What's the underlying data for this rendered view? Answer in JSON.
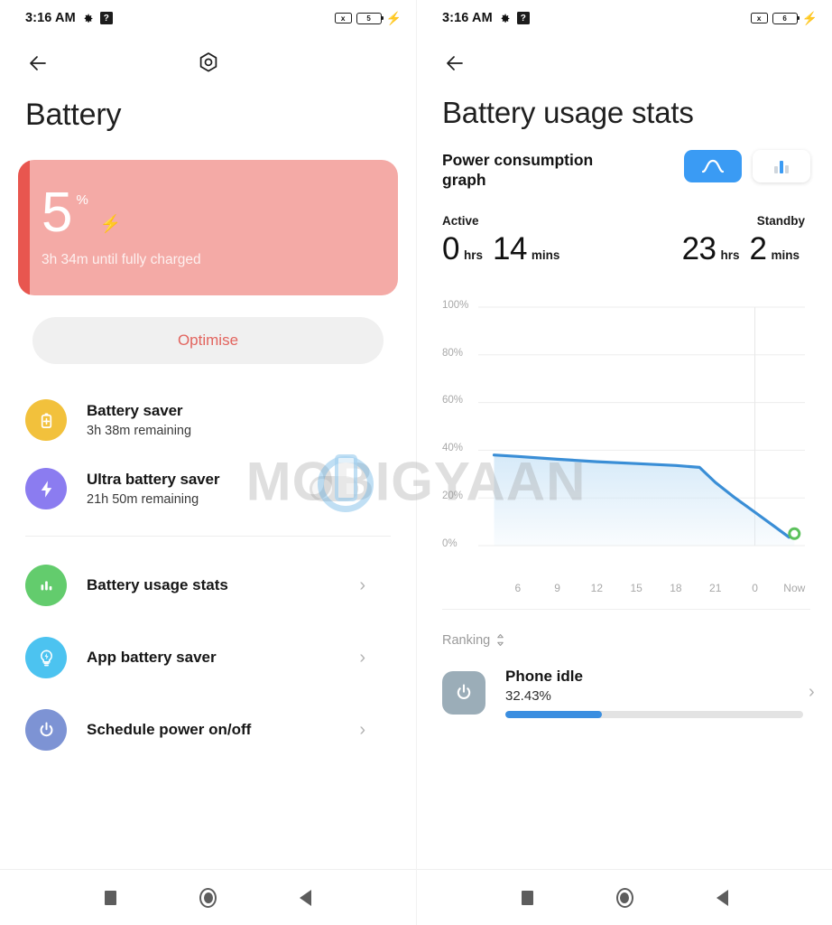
{
  "left": {
    "statusbar": {
      "time": "3:16 AM",
      "gear_icon": "gear-icon",
      "question_icon": "?",
      "x_icon": "x",
      "battery_level": "5",
      "bolt_icon": "⚡"
    },
    "appbar": {
      "back_icon": "back-arrow-icon",
      "settings_icon": "hex-settings-icon"
    },
    "title": "Battery",
    "battery_card": {
      "percent": "5",
      "percent_symbol": "%",
      "charging_icon": "bolt-icon",
      "status": "3h 34m until fully charged",
      "card_color": "#f4aaa6",
      "accent_color": "#e8564f"
    },
    "optimise_label": "Optimise",
    "savers": [
      {
        "title": "Battery saver",
        "subtitle": "3h 38m remaining",
        "icon": "battery-plus-icon",
        "color": "#f2c13c",
        "has_toggle": false
      },
      {
        "title": "Ultra battery saver",
        "subtitle": "21h 50m remaining",
        "icon": "bolt-icon",
        "color": "#8b7cf0",
        "has_toggle": true,
        "toggle_on": false
      }
    ],
    "menu": [
      {
        "label": "Battery usage stats",
        "icon": "bar-chart-icon",
        "color": "#63cc6d",
        "chevron": "›"
      },
      {
        "label": "App battery saver",
        "icon": "bulb-bolt-icon",
        "color": "#4cc3f0",
        "chevron": "›"
      },
      {
        "label": "Schedule power on/off",
        "icon": "power-icon",
        "color": "#7d93d4",
        "chevron": "›"
      }
    ]
  },
  "right": {
    "statusbar": {
      "time": "3:16 AM",
      "gear_icon": "gear-icon",
      "question_icon": "?",
      "x_icon": "x",
      "battery_level": "6",
      "bolt_icon": "⚡"
    },
    "appbar": {
      "back_icon": "back-arrow-icon"
    },
    "title": "Battery usage stats",
    "power_graph": {
      "label": "Power consumption graph",
      "segments": [
        {
          "icon": "line-graph-icon",
          "active": true
        },
        {
          "icon": "bar-graph-icon",
          "active": false
        }
      ],
      "active_color": "#3a9bf4"
    },
    "stats": [
      {
        "label": "Active",
        "hours": "0",
        "hours_unit": "hrs",
        "mins": "14",
        "mins_unit": "mins"
      },
      {
        "label": "Standby",
        "hours": "23",
        "hours_unit": "hrs",
        "mins": "2",
        "mins_unit": "mins"
      }
    ],
    "ranking": {
      "label": "Ranking",
      "sort_icon": "sort-updown-icon"
    },
    "apps": [
      {
        "name": "Phone idle",
        "percent": "32.43%",
        "percent_value": 32.43,
        "icon": "power-icon",
        "icon_color": "#9badb8",
        "bar_color": "#3a8ee0",
        "chevron": "›"
      }
    ]
  },
  "navbar": {
    "recents_icon": "square-icon",
    "home_icon": "circle-icon",
    "back_icon": "triangle-back-icon"
  },
  "watermark": {
    "text": "MOBIGYAAN"
  },
  "chart_data": {
    "type": "area",
    "title": "Power consumption graph",
    "xlabel": "",
    "ylabel": "",
    "ylim": [
      0,
      100
    ],
    "ytick_labels": [
      "100%",
      "80%",
      "60%",
      "40%",
      "20%",
      "0%"
    ],
    "ytick_values": [
      100,
      80,
      60,
      40,
      20,
      0
    ],
    "xtick_labels": [
      "6",
      "9",
      "12",
      "15",
      "18",
      "21",
      "0",
      "Now"
    ],
    "xtick_values": [
      6,
      9,
      12,
      15,
      18,
      21,
      24,
      27
    ],
    "grid": true,
    "legend": "none",
    "line_color": "#3a8ed6",
    "fill_color": "#cfe6f7",
    "marker_color": "#5cc15c",
    "marker_label": "Now",
    "vertical_marker_x": 24,
    "x": [
      4.2,
      6,
      9,
      12,
      15,
      18,
      19.8,
      21,
      22.5,
      24,
      25.5,
      26.6,
      27
    ],
    "y": [
      38,
      37.4,
      36.2,
      35.2,
      34.4,
      33.6,
      32.8,
      26.5,
      20,
      14,
      8,
      3.5,
      5
    ]
  }
}
